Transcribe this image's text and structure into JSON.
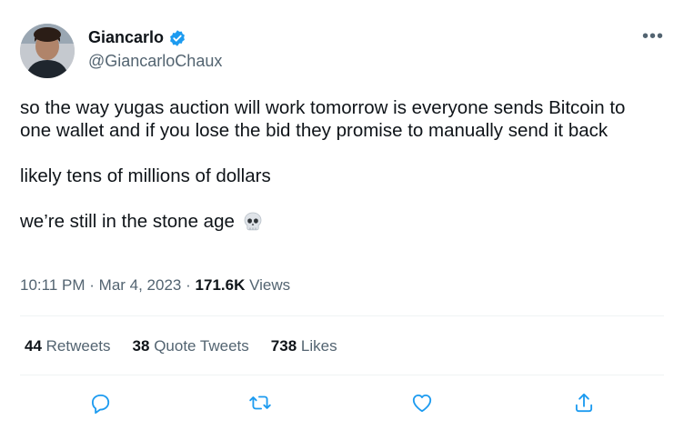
{
  "tweet": {
    "display_name": "Giancarlo",
    "handle": "@GiancarloChaux",
    "more_label": "•••",
    "paragraphs": [
      "so the way yugas auction will work tomorrow is everyone sends Bitcoin to one wallet and if you lose the bid they promise to manually send it back",
      "likely tens of millions of dollars"
    ],
    "last_line": "we’re still in the stone age",
    "time": "10:11 PM",
    "date": "Mar 4, 2023",
    "separator": "·",
    "views_count": "171.6K",
    "views_label": "Views"
  },
  "stats": {
    "retweets_count": "44",
    "retweets_label": "Retweets",
    "quotes_count": "38",
    "quotes_label": "Quote Tweets",
    "likes_count": "738",
    "likes_label": "Likes"
  },
  "icons": {
    "verified": "verified-badge-icon",
    "skull": "skull-emoji",
    "reply": "reply-icon",
    "retweet": "retweet-icon",
    "like": "heart-icon",
    "share": "share-icon"
  },
  "colors": {
    "accent": "#1d9bf0",
    "text": "#0f1419",
    "secondary": "#536471",
    "divider": "#eff3f4"
  }
}
